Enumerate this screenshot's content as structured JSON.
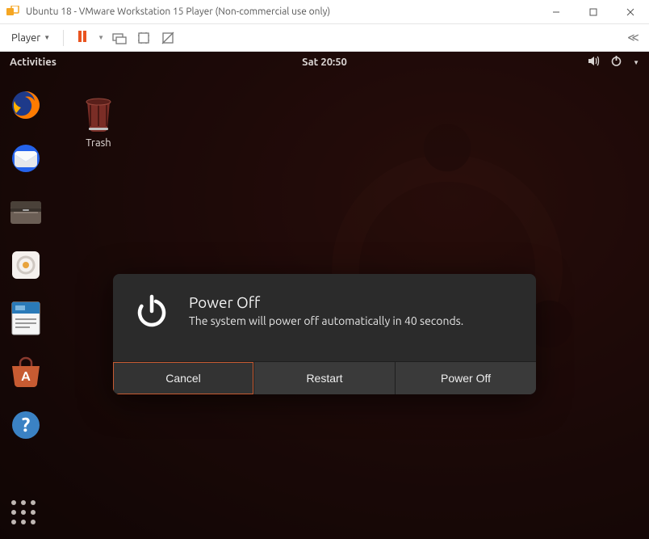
{
  "host": {
    "window_title": "Ubuntu 18 - VMware Workstation 15 Player (Non-commercial use only)",
    "player_menu_label": "Player"
  },
  "guest": {
    "topbar": {
      "activities": "Activities",
      "clock": "Sat 20:50"
    },
    "desktop": {
      "trash_label": "Trash"
    },
    "dialog": {
      "title": "Power Off",
      "message": "The system will power off automatically in 40 seconds.",
      "buttons": {
        "cancel": "Cancel",
        "restart": "Restart",
        "power_off": "Power Off"
      }
    }
  }
}
